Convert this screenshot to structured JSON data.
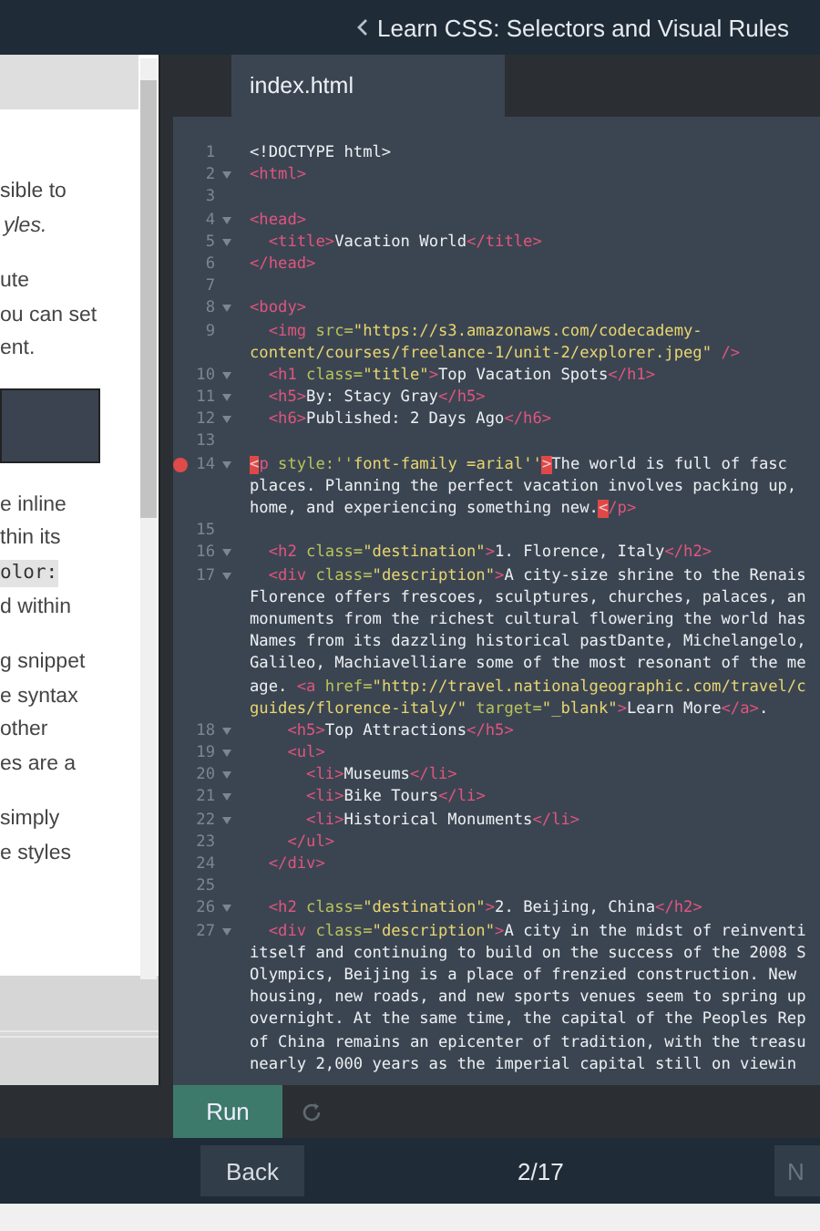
{
  "header": {
    "title": "Learn CSS: Selectors and Visual Rules"
  },
  "lesson": {
    "blocks": [
      {
        "kind": "para",
        "lines": [
          {
            "text": "sible to",
            "kind": "plain"
          },
          {
            "text": "yles.",
            "kind": "italic"
          }
        ]
      },
      {
        "kind": "para",
        "lines": [
          {
            "text": "ute",
            "kind": "plain"
          },
          {
            "text": "ou can set",
            "kind": "plain"
          },
          {
            "text": "ent.",
            "kind": "plain"
          }
        ]
      },
      {
        "kind": "code_block"
      },
      {
        "kind": "para",
        "lines": [
          {
            "text": "e inline",
            "kind": "plain"
          },
          {
            "text": "thin its",
            "kind": "plain"
          },
          {
            "text": "olor:",
            "kind": "code"
          },
          {
            "text": "d within",
            "kind": "plain"
          }
        ]
      },
      {
        "kind": "para",
        "lines": [
          {
            "text": "g snippet",
            "kind": "plain"
          },
          {
            "text": "e syntax",
            "kind": "plain"
          },
          {
            "text": "other",
            "kind": "plain"
          },
          {
            "text": "es are a",
            "kind": "plain"
          }
        ]
      },
      {
        "kind": "para",
        "lines": [
          {
            "text": "simply",
            "kind": "plain"
          },
          {
            "text": "e styles",
            "kind": "plain"
          }
        ]
      }
    ]
  },
  "editor": {
    "tabs": [
      {
        "label": "index.html",
        "selected": true
      }
    ],
    "lines": [
      {
        "number": "1",
        "fold": false,
        "breakpoint": false,
        "rows": [
          {
            "segments": [
              {
                "kind": "text",
                "text": "<!DOCTYPE html>"
              }
            ]
          }
        ]
      },
      {
        "number": "2",
        "fold": true,
        "breakpoint": false,
        "rows": [
          {
            "segments": [
              {
                "kind": "tag",
                "text": "<html>"
              }
            ]
          }
        ]
      },
      {
        "number": "3",
        "fold": false,
        "breakpoint": false
      },
      {
        "number": "4",
        "fold": true,
        "breakpoint": false,
        "rows": [
          {
            "segments": [
              {
                "kind": "tag",
                "text": "<head>"
              }
            ]
          }
        ]
      },
      {
        "number": "5",
        "fold": true,
        "breakpoint": false,
        "rows": [
          {
            "segments": [
              {
                "kind": "tag",
                "text": "  <title>"
              },
              {
                "kind": "text",
                "text": "Vacation World"
              },
              {
                "kind": "tag",
                "text": "</title>"
              }
            ]
          }
        ]
      },
      {
        "number": "6",
        "fold": false,
        "breakpoint": false,
        "rows": [
          {
            "segments": [
              {
                "kind": "tag",
                "text": "</head>"
              }
            ]
          }
        ]
      },
      {
        "number": "7",
        "fold": false,
        "breakpoint": false
      },
      {
        "number": "8",
        "fold": true,
        "breakpoint": false,
        "rows": [
          {
            "segments": [
              {
                "kind": "tag",
                "text": "<body>"
              }
            ]
          }
        ]
      },
      {
        "number": "9",
        "fold": false,
        "breakpoint": false,
        "rows": [
          {
            "segments": [
              {
                "kind": "tag",
                "text": "  <img "
              },
              {
                "kind": "attr",
                "text": "src="
              },
              {
                "kind": "str",
                "text": "\"https://s3.amazonaws.com/codecademy-"
              }
            ]
          },
          {
            "segments": [
              {
                "kind": "str",
                "text": "content/courses/freelance-1/unit-2/explorer.jpeg\""
              },
              {
                "kind": "tag",
                "text": " />"
              }
            ]
          }
        ]
      },
      {
        "number": "10",
        "fold": true,
        "breakpoint": false,
        "rows": [
          {
            "segments": [
              {
                "kind": "tag",
                "text": "  <h1 "
              },
              {
                "kind": "attr",
                "text": "class="
              },
              {
                "kind": "str",
                "text": "\"title\""
              },
              {
                "kind": "tag",
                "text": ">"
              },
              {
                "kind": "text",
                "text": "Top Vacation Spots"
              },
              {
                "kind": "tag",
                "text": "</h1>"
              }
            ]
          }
        ]
      },
      {
        "number": "11",
        "fold": true,
        "breakpoint": false,
        "rows": [
          {
            "segments": [
              {
                "kind": "tag",
                "text": "  <h5>"
              },
              {
                "kind": "text",
                "text": "By: Stacy Gray"
              },
              {
                "kind": "tag",
                "text": "</h5>"
              }
            ]
          }
        ]
      },
      {
        "number": "12",
        "fold": true,
        "breakpoint": false,
        "rows": [
          {
            "segments": [
              {
                "kind": "tag",
                "text": "  <h6>"
              },
              {
                "kind": "text",
                "text": "Published: 2 Days Ago"
              },
              {
                "kind": "tag",
                "text": "</h6>"
              }
            ]
          }
        ]
      },
      {
        "number": "13",
        "fold": false,
        "breakpoint": false
      },
      {
        "number": "14",
        "fold": true,
        "breakpoint": true,
        "rows": [
          {
            "segments": [
              {
                "kind": "error",
                "text": "<"
              },
              {
                "kind": "tag",
                "text": "p "
              },
              {
                "kind": "attr",
                "text": "style:''"
              },
              {
                "kind": "str",
                "text": "font-family =arial''"
              },
              {
                "kind": "error",
                "text": ">"
              },
              {
                "kind": "text",
                "text": "The world is full of fasc"
              }
            ]
          },
          {
            "segments": [
              {
                "kind": "text",
                "text": "places. Planning the perfect vacation involves packing up,"
              }
            ]
          },
          {
            "segments": [
              {
                "kind": "text",
                "text": "home, and experiencing something new."
              },
              {
                "kind": "error",
                "text": "<"
              },
              {
                "kind": "tag",
                "text": "/p>"
              }
            ]
          }
        ]
      },
      {
        "number": "15",
        "fold": false,
        "breakpoint": false
      },
      {
        "number": "16",
        "fold": true,
        "breakpoint": false,
        "rows": [
          {
            "segments": [
              {
                "kind": "tag",
                "text": "  <h2 "
              },
              {
                "kind": "attr",
                "text": "class="
              },
              {
                "kind": "str",
                "text": "\"destination\""
              },
              {
                "kind": "tag",
                "text": ">"
              },
              {
                "kind": "text",
                "text": "1. Florence, Italy"
              },
              {
                "kind": "tag",
                "text": "</h2>"
              }
            ]
          }
        ]
      },
      {
        "number": "17",
        "fold": true,
        "breakpoint": false,
        "rows": [
          {
            "segments": [
              {
                "kind": "tag",
                "text": "  <div "
              },
              {
                "kind": "attr",
                "text": "class="
              },
              {
                "kind": "str",
                "text": "\"description\""
              },
              {
                "kind": "tag",
                "text": ">"
              },
              {
                "kind": "text",
                "text": "A city-size shrine to the Renais"
              }
            ]
          },
          {
            "segments": [
              {
                "kind": "text",
                "text": "Florence offers frescoes, sculptures, churches, palaces, an"
              }
            ]
          },
          {
            "segments": [
              {
                "kind": "text",
                "text": "monuments from the richest cultural flowering the world has"
              }
            ]
          },
          {
            "segments": [
              {
                "kind": "text",
                "text": "Names from its dazzling historical pastDante, Michelangelo,"
              }
            ]
          },
          {
            "segments": [
              {
                "kind": "text",
                "text": "Galileo, Machiavelliare some of the most resonant of the me"
              }
            ]
          },
          {
            "segments": [
              {
                "kind": "text",
                "text": "age. "
              },
              {
                "kind": "tag",
                "text": "<a "
              },
              {
                "kind": "attr",
                "text": "href="
              },
              {
                "kind": "str",
                "text": "\"http://travel.nationalgeographic.com/travel/c"
              }
            ]
          },
          {
            "segments": [
              {
                "kind": "str",
                "text": "guides/florence-italy/\""
              },
              {
                "kind": "attr",
                "text": " target="
              },
              {
                "kind": "str",
                "text": "\"_blank\""
              },
              {
                "kind": "tag",
                "text": ">"
              },
              {
                "kind": "text",
                "text": "Learn More"
              },
              {
                "kind": "tag",
                "text": "</a>"
              },
              {
                "kind": "text",
                "text": "."
              }
            ]
          }
        ]
      },
      {
        "number": "18",
        "fold": true,
        "breakpoint": false,
        "rows": [
          {
            "segments": [
              {
                "kind": "tag",
                "text": "    <h5>"
              },
              {
                "kind": "text",
                "text": "Top Attractions"
              },
              {
                "kind": "tag",
                "text": "</h5>"
              }
            ]
          }
        ]
      },
      {
        "number": "19",
        "fold": true,
        "breakpoint": false,
        "rows": [
          {
            "segments": [
              {
                "kind": "tag",
                "text": "    <ul>"
              }
            ]
          }
        ]
      },
      {
        "number": "20",
        "fold": true,
        "breakpoint": false,
        "rows": [
          {
            "segments": [
              {
                "kind": "tag",
                "text": "      <li>"
              },
              {
                "kind": "text",
                "text": "Museums"
              },
              {
                "kind": "tag",
                "text": "</li>"
              }
            ]
          }
        ]
      },
      {
        "number": "21",
        "fold": true,
        "breakpoint": false,
        "rows": [
          {
            "segments": [
              {
                "kind": "tag",
                "text": "      <li>"
              },
              {
                "kind": "text",
                "text": "Bike Tours"
              },
              {
                "kind": "tag",
                "text": "</li>"
              }
            ]
          }
        ]
      },
      {
        "number": "22",
        "fold": true,
        "breakpoint": false,
        "rows": [
          {
            "segments": [
              {
                "kind": "tag",
                "text": "      <li>"
              },
              {
                "kind": "text",
                "text": "Historical Monuments"
              },
              {
                "kind": "tag",
                "text": "</li>"
              }
            ]
          }
        ]
      },
      {
        "number": "23",
        "fold": false,
        "breakpoint": false,
        "rows": [
          {
            "segments": [
              {
                "kind": "tag",
                "text": "    </ul>"
              }
            ]
          }
        ]
      },
      {
        "number": "24",
        "fold": false,
        "breakpoint": false,
        "rows": [
          {
            "segments": [
              {
                "kind": "tag",
                "text": "  </div>"
              }
            ]
          }
        ]
      },
      {
        "number": "25",
        "fold": false,
        "breakpoint": false
      },
      {
        "number": "26",
        "fold": true,
        "breakpoint": false,
        "rows": [
          {
            "segments": [
              {
                "kind": "tag",
                "text": "  <h2 "
              },
              {
                "kind": "attr",
                "text": "class="
              },
              {
                "kind": "str",
                "text": "\"destination\""
              },
              {
                "kind": "tag",
                "text": ">"
              },
              {
                "kind": "text",
                "text": "2. Beijing, China"
              },
              {
                "kind": "tag",
                "text": "</h2>"
              }
            ]
          }
        ]
      },
      {
        "number": "27",
        "fold": true,
        "breakpoint": false,
        "rows": [
          {
            "segments": [
              {
                "kind": "tag",
                "text": "  <div "
              },
              {
                "kind": "attr",
                "text": "class="
              },
              {
                "kind": "str",
                "text": "\"description\""
              },
              {
                "kind": "tag",
                "text": ">"
              },
              {
                "kind": "text",
                "text": "A city in the midst of reinventi"
              }
            ]
          },
          {
            "segments": [
              {
                "kind": "text",
                "text": "itself and continuing to build on the success of the 2008 S"
              }
            ]
          },
          {
            "segments": [
              {
                "kind": "text",
                "text": "Olympics, Beijing is a place of frenzied construction. New"
              }
            ]
          },
          {
            "segments": [
              {
                "kind": "text",
                "text": "housing, new roads, and new sports venues seem to spring up"
              }
            ]
          },
          {
            "segments": [
              {
                "kind": "text",
                "text": "overnight. At the same time, the capital of the Peoples Rep"
              }
            ]
          },
          {
            "segments": [
              {
                "kind": "text",
                "text": "of China remains an epicenter of tradition, with the treasu"
              }
            ]
          },
          {
            "segments": [
              {
                "kind": "text",
                "text": "nearly 2,000 years as the imperial capital still on viewin"
              }
            ]
          }
        ]
      }
    ],
    "run_button": "Run"
  },
  "nav": {
    "back": "Back",
    "progress": "2/17",
    "next": "N"
  }
}
